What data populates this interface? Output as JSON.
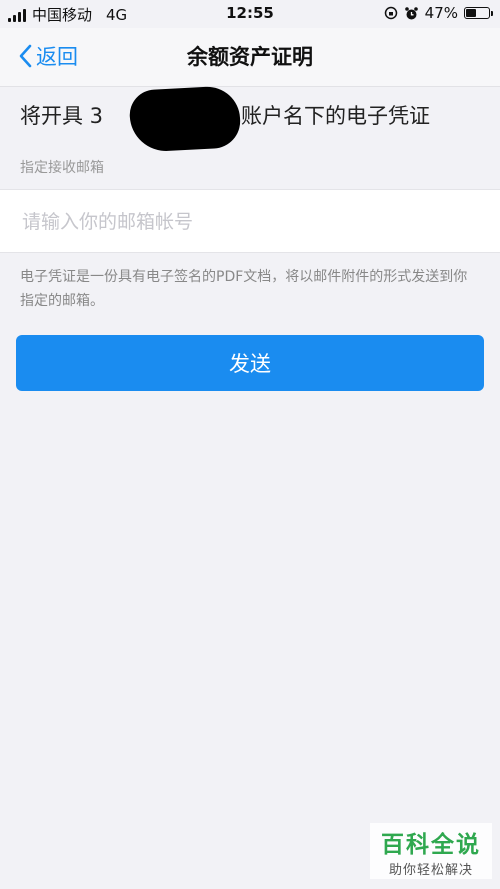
{
  "status_bar": {
    "carrier": "中国移动",
    "network": "4G",
    "time": "12:55",
    "battery_percent": "47%",
    "battery_level": 0.47
  },
  "nav": {
    "back_label": "返回",
    "title": "余额资产证明"
  },
  "certificate": {
    "prefix": "将开具 3",
    "suffix": "n 账户名下的电子凭证"
  },
  "email_section": {
    "label": "指定接收邮箱",
    "placeholder": "请输入你的邮箱帐号",
    "value": ""
  },
  "hint": "电子凭证是一份具有电子签名的PDF文档，将以邮件附件的形式发送到你指定的邮箱。",
  "send_button": "发送",
  "watermark": {
    "title": "百科全说",
    "subtitle": "助你轻松解决"
  },
  "colors": {
    "accent": "#1a8cf0",
    "background": "#f2f2f6",
    "watermark_green": "#2fa84f"
  }
}
